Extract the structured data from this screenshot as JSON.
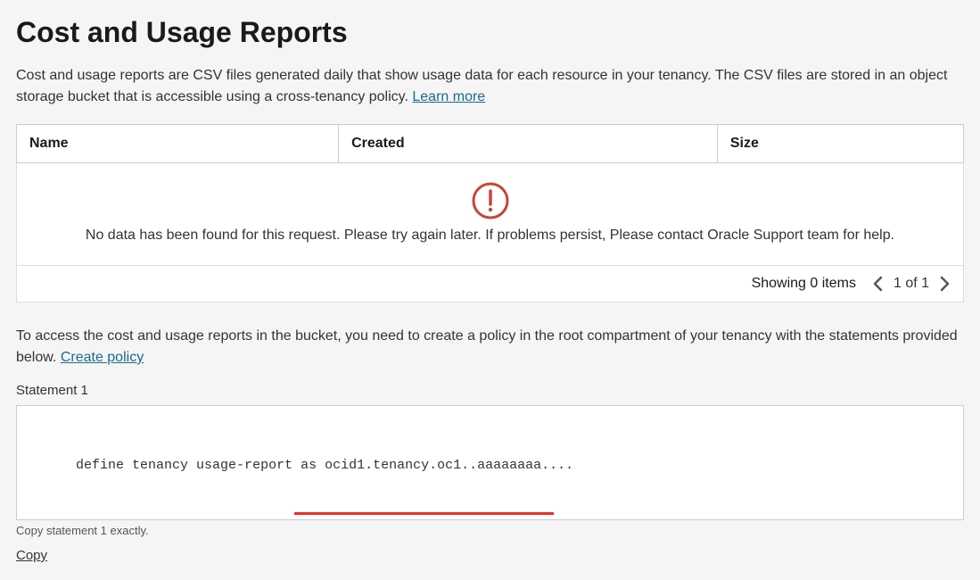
{
  "page": {
    "title": "Cost and Usage Reports",
    "intro": "Cost and usage reports are CSV files generated daily that show usage data for each resource in your tenancy. The CSV files are stored in an object storage bucket that is accessible using a cross-tenancy policy. ",
    "learn_more": "Learn more"
  },
  "table": {
    "headers": {
      "name": "Name",
      "created": "Created",
      "size": "Size"
    },
    "empty_message": "No data has been found for this request. Please try again later. If problems persist, Please contact Oracle Support team for help.",
    "pagination": {
      "showing": "Showing 0 items",
      "page": "1 of 1"
    }
  },
  "policy": {
    "intro": "To access the cost and usage reports in the bucket, you need to create a policy in the root compartment of your tenancy with the statements provided below. ",
    "create_link": "Create policy",
    "statement_label": "Statement 1",
    "statement_text": "define tenancy usage-report as ocid1.tenancy.oc1..aaaaaaaa....",
    "copy_hint": "Copy statement 1 exactly.",
    "copy_button": "Copy"
  }
}
